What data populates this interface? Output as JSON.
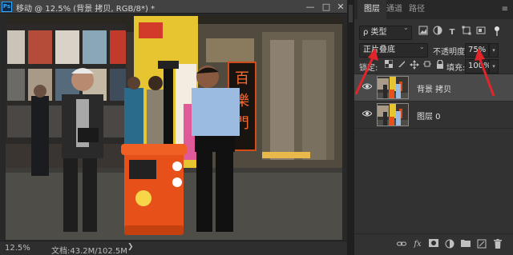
{
  "app": {
    "logo": "Ps"
  },
  "document": {
    "tab_title": "移动 @ 12.5% (背景 拷贝, RGB/8*) *",
    "window_buttons": {
      "minimize": "—",
      "maximize": "□",
      "close": "✕"
    },
    "status": {
      "zoom": "12.5%",
      "doc_size": "文档:43.2M/102.5M",
      "arrow": "❯"
    },
    "photo_signs": {
      "sign1": "百",
      "sign2": "樂",
      "sign3": "門"
    }
  },
  "panel": {
    "tabs": [
      {
        "label": "图层",
        "active": true
      },
      {
        "label": "通道",
        "active": false
      },
      {
        "label": "路径",
        "active": false
      }
    ],
    "menu_icon": "≡",
    "filter": {
      "label": "ρ 类型",
      "chevron": "⌄",
      "icons": [
        "image-filter-icon",
        "adjustment-filter-icon",
        "type-filter-icon",
        "shape-filter-icon",
        "smart-object-filter-icon",
        "filter-toggle-icon"
      ]
    },
    "blend_mode": "正片叠底",
    "opacity_label": "不透明度:",
    "opacity_value": "75%",
    "lock_label": "锁定:",
    "fill_label": "填充:",
    "fill_value": "100%",
    "layers": [
      {
        "name": "背景 拷贝",
        "selected": true,
        "visible": true
      },
      {
        "name": "图层 0",
        "selected": false,
        "visible": true
      }
    ],
    "footer_icons": [
      "link-icon",
      "fx-icon",
      "mask-icon",
      "adjustment-icon",
      "group-icon",
      "new-layer-icon",
      "trash-icon"
    ],
    "footer_fx_text": "fx"
  },
  "colors": {
    "annotation": "#e0262b",
    "selected_layer": "#4a4a4a",
    "panel_bg": "#323232"
  }
}
